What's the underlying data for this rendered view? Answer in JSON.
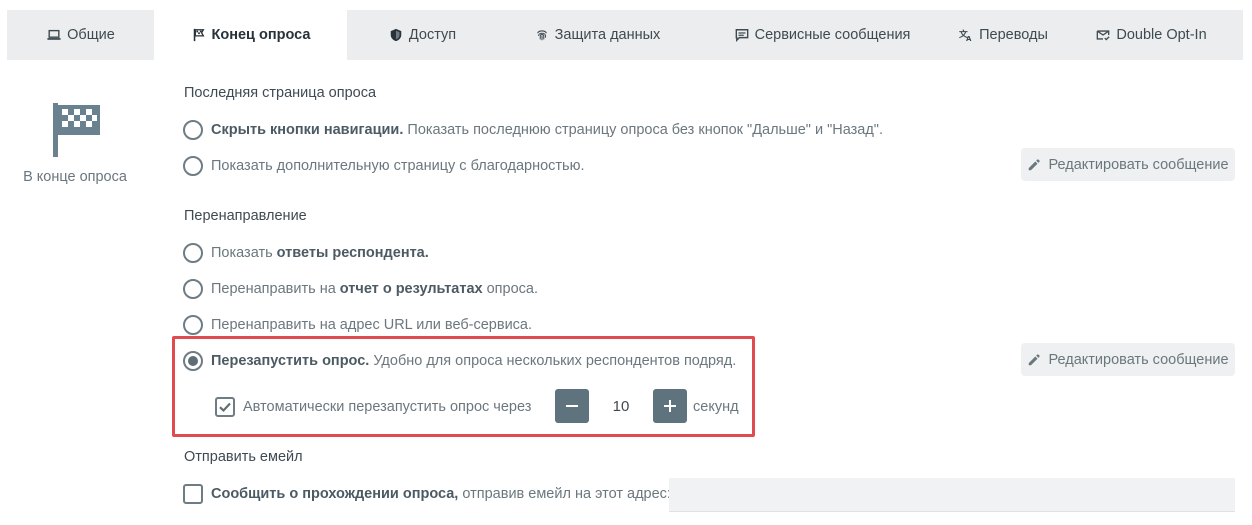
{
  "tabs": [
    {
      "label": "Общие",
      "icon": "laptop-icon",
      "active": false
    },
    {
      "label": "Конец опроса",
      "icon": "flag-icon",
      "active": true
    },
    {
      "label": "Доступ",
      "icon": "shield-icon",
      "active": false
    },
    {
      "label": "Защита данных",
      "icon": "fingerprint-icon",
      "active": false
    },
    {
      "label": "Сервисные сообщения",
      "icon": "message-icon",
      "active": false
    },
    {
      "label": "Переводы",
      "icon": "translate-icon",
      "active": false
    },
    {
      "label": "Double Opt-In",
      "icon": "mail-check-icon",
      "active": false
    }
  ],
  "sidebar": {
    "icon": "checkered-flag-icon",
    "label": "В конце опроса"
  },
  "last_page": {
    "title": "Последняя страница опроса",
    "hide_nav": {
      "bold": "Скрыть кнопки навигации.",
      "rest": " Показать последнюю страницу опроса без кнопок \"Дальше\" и \"Назад\".",
      "checked": false
    },
    "thank_you": {
      "text": "Показать дополнительную страницу с благодарностью.",
      "checked": false
    },
    "edit_button": "Редактировать сообщение"
  },
  "redirect": {
    "title": "Перенаправление",
    "show_answers": {
      "pre": "Показать ",
      "bold": "ответы респондента.",
      "checked": false
    },
    "to_report": {
      "pre": "Перенаправить на ",
      "bold": "отчет о результатах",
      "post": " опроса.",
      "checked": false
    },
    "to_url": {
      "text": "Перенаправить на адрес URL или веб-сервиса.",
      "checked": false
    },
    "restart": {
      "bold": "Перезапустить опрос.",
      "rest": " Удобно для опроса нескольких респондентов подряд.",
      "checked": true
    },
    "edit_button": "Редактировать сообщение",
    "auto_restart": {
      "label": "Автоматически перезапустить опрос через",
      "checked": true,
      "value": "10",
      "unit": "секунд"
    }
  },
  "email": {
    "title": "Отправить емейл",
    "notify": {
      "bold": "Сообщить о прохождении опроса,",
      "rest": " отправив емейл на этот адрес:",
      "checked": false
    },
    "address_value": ""
  },
  "colors": {
    "highlight": "#e04b4f",
    "stepper": "#5f737e",
    "tabbar_bg": "#ecedee"
  }
}
